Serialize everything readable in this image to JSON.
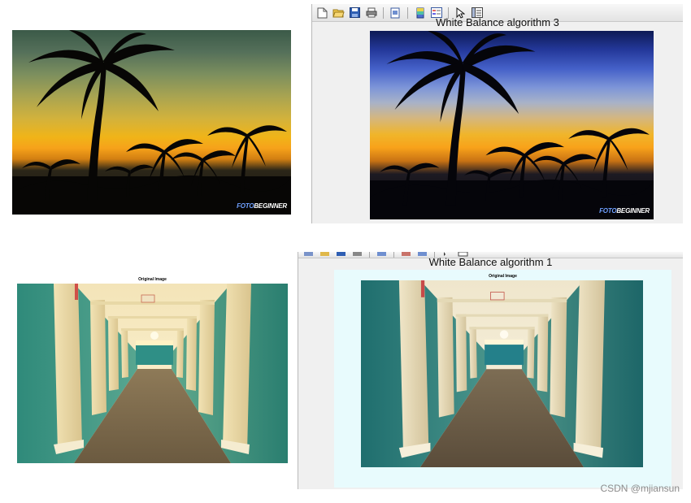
{
  "panels": {
    "sunset_original": {
      "watermark_brand": "FOTO",
      "watermark_text": "BEGINNER"
    },
    "figure_top": {
      "title": "White Balance algorithm 3",
      "toolbar_icons": [
        "new-figure-icon",
        "open-file-icon",
        "save-icon",
        "print-icon",
        "print-preview-icon",
        "colorbar-icon",
        "legend-icon",
        "select-arrow-icon",
        "property-editor-icon"
      ],
      "image": {
        "watermark_brand": "FOTO",
        "watermark_text": "BEGINNER"
      }
    },
    "hall_original": {
      "title": "Original Image"
    },
    "figure_bottom": {
      "title": "White Balance algorithm 1",
      "subplot_title": "Original Image",
      "axes_background": "#e8fbfd"
    }
  },
  "colors": {
    "page_background": "#ffffff",
    "figure_background": "#f0f0f0",
    "exit_sign": "#d43a2a"
  },
  "footer": {
    "watermark": "CSDN @mjiansun"
  }
}
